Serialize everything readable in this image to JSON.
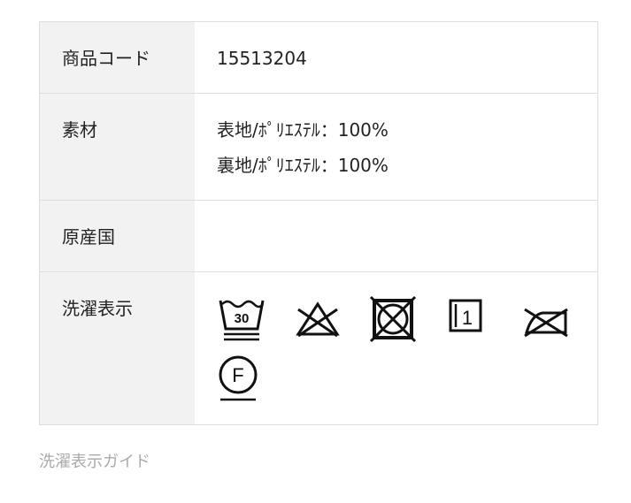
{
  "spec": {
    "code_label": "商品コード",
    "code_value": "15513204",
    "material_label": "素材",
    "material_lines": [
      "表地/ﾎﾟﾘｴｽﾃﾙ：100%",
      "裏地/ﾎﾟﾘｴｽﾃﾙ：100%"
    ],
    "origin_label": "原産国",
    "origin_value": "",
    "wash_label": "洗濯表示",
    "wash_icons": [
      {
        "name": "wash-30-gentle-icon",
        "text": "30"
      },
      {
        "name": "do-not-bleach-icon"
      },
      {
        "name": "do-not-tumble-dry-icon"
      },
      {
        "name": "drip-dry-vertical-icon",
        "text": "1"
      },
      {
        "name": "do-not-iron-icon"
      },
      {
        "name": "dry-clean-f-icon",
        "text": "F"
      }
    ]
  },
  "guide_link": "洗濯表示ガイド"
}
